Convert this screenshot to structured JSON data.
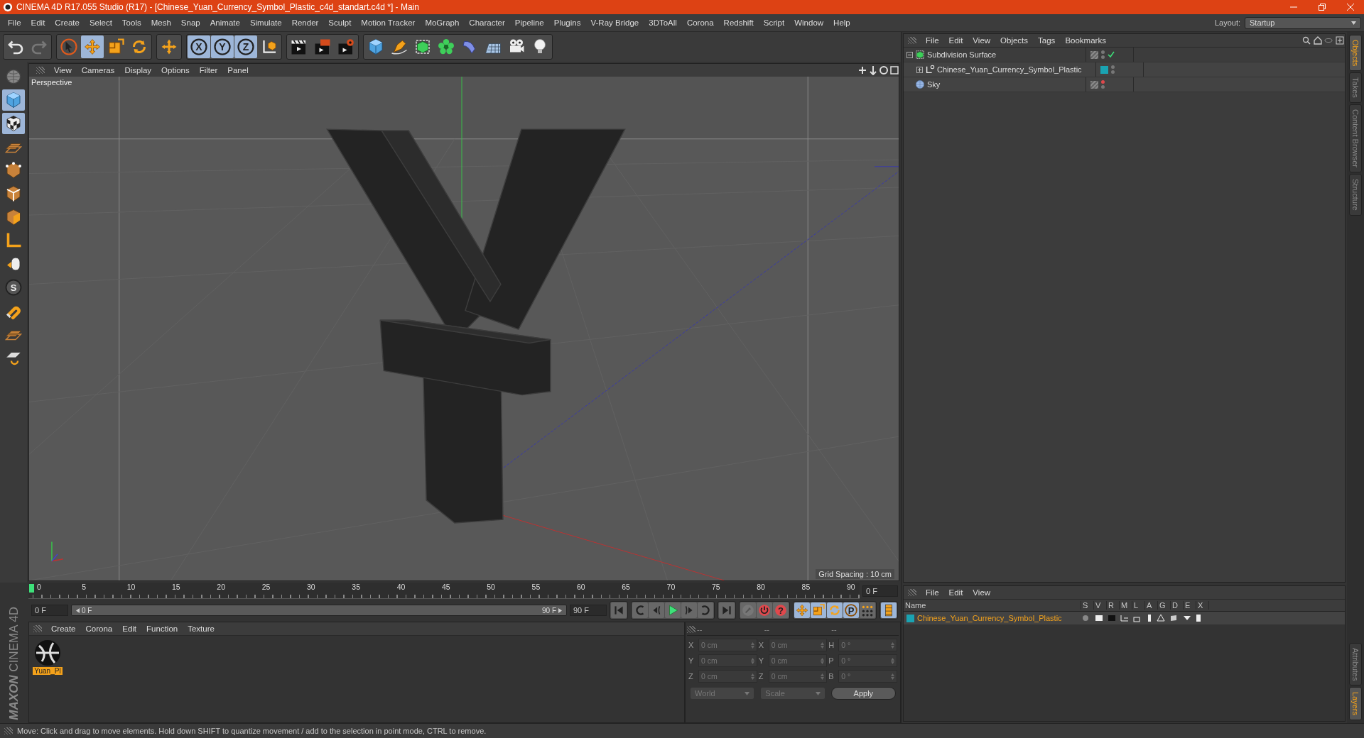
{
  "window": {
    "title": "CINEMA 4D R17.055 Studio (R17) - [Chinese_Yuan_Currency_Symbol_Plastic_c4d_standart.c4d *] - Main"
  },
  "menu": [
    "File",
    "Edit",
    "Create",
    "Select",
    "Tools",
    "Mesh",
    "Snap",
    "Animate",
    "Simulate",
    "Render",
    "Sculpt",
    "Motion Tracker",
    "MoGraph",
    "Character",
    "Pipeline",
    "Plugins",
    "V-Ray Bridge",
    "3DToAll",
    "Corona",
    "Redshift",
    "Script",
    "Window",
    "Help"
  ],
  "layout": {
    "label": "Layout:",
    "value": "Startup"
  },
  "toolbar": [
    [
      {
        "kind": "undo",
        "selected": false
      },
      {
        "kind": "redo",
        "selected": false
      }
    ],
    [
      {
        "kind": "select",
        "selected": false
      },
      {
        "kind": "move",
        "selected": true
      },
      {
        "kind": "scale",
        "selected": false
      },
      {
        "kind": "rotate",
        "selected": false
      }
    ],
    [
      {
        "kind": "cross",
        "selected": false
      }
    ],
    [
      {
        "kind": "axis",
        "label": "X",
        "selected": true
      },
      {
        "kind": "axis",
        "label": "Y",
        "selected": true
      },
      {
        "kind": "axis",
        "label": "Z",
        "selected": true
      },
      {
        "kind": "coord",
        "selected": false
      }
    ],
    [
      {
        "kind": "render",
        "selected": false
      },
      {
        "kind": "render-view",
        "selected": false
      },
      {
        "kind": "render-settings",
        "selected": false
      }
    ],
    [
      {
        "kind": "cube",
        "selected": false
      },
      {
        "kind": "pen",
        "selected": false
      },
      {
        "kind": "subdiv",
        "selected": false
      },
      {
        "kind": "cloner",
        "selected": false
      },
      {
        "kind": "deformer",
        "selected": false
      },
      {
        "kind": "floor",
        "selected": false
      },
      {
        "kind": "camera",
        "selected": false
      },
      {
        "kind": "light",
        "selected": false
      }
    ]
  ],
  "tool_strip": [
    {
      "kind": "model",
      "selected": false
    },
    {
      "kind": "cube",
      "selected": true
    },
    {
      "kind": "texture",
      "selected": true
    },
    {
      "kind": "workplane",
      "selected": false
    },
    {
      "kind": "points",
      "selected": false
    },
    {
      "kind": "edges",
      "selected": false
    },
    {
      "kind": "polys",
      "selected": false
    },
    {
      "kind": "coord-l",
      "selected": false
    },
    {
      "kind": "tweak",
      "selected": false
    },
    {
      "kind": "snap",
      "label": "S",
      "selected": false
    },
    {
      "kind": "magnet",
      "selected": false
    },
    {
      "kind": "workplane",
      "selected": false
    },
    {
      "kind": "workplane-snap",
      "selected": false
    }
  ],
  "viewport": {
    "menu": [
      "View",
      "Cameras",
      "Display",
      "Options",
      "Filter",
      "Panel"
    ],
    "camera": "Perspective",
    "grid_spacing": "Grid Spacing : 10 cm"
  },
  "timeline": {
    "ticks": [
      "0",
      "5",
      "10",
      "15",
      "20",
      "25",
      "30",
      "35",
      "40",
      "45",
      "50",
      "55",
      "60",
      "65",
      "70",
      "75",
      "80",
      "85",
      "90"
    ],
    "current_frame": "0 F"
  },
  "playback": {
    "start": "0 F",
    "range_start": "0 F",
    "range_end": "90 F",
    "end": "90 F",
    "buttons": [
      [
        {
          "kind": "go-start",
          "selected": false
        }
      ],
      [
        {
          "kind": "prev-key",
          "selected": false
        },
        {
          "kind": "prev-frame",
          "selected": false
        },
        {
          "kind": "play",
          "selected": false
        },
        {
          "kind": "next-frame",
          "selected": false
        },
        {
          "kind": "next-key",
          "selected": false
        }
      ],
      [
        {
          "kind": "go-end",
          "selected": false
        }
      ],
      [
        {
          "kind": "key",
          "selected": false
        },
        {
          "kind": "autokey",
          "selected": false
        },
        {
          "kind": "help",
          "label": "?",
          "selected": false
        }
      ],
      [
        {
          "kind": "move",
          "selected": true
        },
        {
          "kind": "scale",
          "selected": true
        },
        {
          "kind": "rotate",
          "selected": true
        },
        {
          "kind": "param",
          "label": "P",
          "selected": true
        },
        {
          "kind": "dots",
          "selected": false
        }
      ],
      [
        {
          "kind": "film",
          "selected": true
        }
      ]
    ]
  },
  "materials": {
    "menu": [
      "Create",
      "Corona",
      "Edit",
      "Function",
      "Texture"
    ],
    "items": [
      {
        "name": "Yuan_Pl",
        "selected": true
      }
    ]
  },
  "coordinates": {
    "headers": [
      "--",
      "--",
      "--"
    ],
    "rows": [
      {
        "axis_1": "X",
        "value_1": "0 cm",
        "axis_2": "X",
        "value_2": "0 cm",
        "axis_3": "H",
        "value_3": "0 °"
      },
      {
        "axis_1": "Y",
        "value_1": "0 cm",
        "axis_2": "Y",
        "value_2": "0 cm",
        "axis_3": "P",
        "value_3": "0 °"
      },
      {
        "axis_1": "Z",
        "value_1": "0 cm",
        "axis_2": "Z",
        "value_2": "0 cm",
        "axis_3": "B",
        "value_3": "0 °"
      }
    ],
    "dropdowns": [
      "World",
      "Scale"
    ],
    "apply": "Apply"
  },
  "status_bar": "Move: Click and drag to move elements. Hold down SHIFT to quantize movement / add to the selection in point mode, CTRL to remove.",
  "object_manager": {
    "menu": [
      "File",
      "Edit",
      "View",
      "Objects",
      "Tags",
      "Bookmarks"
    ],
    "objects": [
      {
        "name": "Subdivision Surface",
        "kind": "subdiv",
        "expanded": true,
        "enabled": true,
        "editor_hidden": false,
        "children": [
          {
            "name": "Chinese_Yuan_Currency_Symbol_Plastic",
            "kind": "null",
            "expanded": false,
            "enabled": false,
            "editor_hidden": false,
            "color": "#1aa3b2"
          }
        ]
      },
      {
        "name": "Sky",
        "kind": "sky",
        "enabled": false,
        "editor_hidden": true
      }
    ]
  },
  "layer_manager": {
    "menu": [
      "File",
      "Edit",
      "View"
    ],
    "columns": [
      "Name",
      "S",
      "V",
      "R",
      "M",
      "L",
      "A",
      "G",
      "D",
      "E",
      "X"
    ],
    "layers": [
      {
        "name": "Chinese_Yuan_Currency_Symbol_Plastic",
        "color": "#1aa3b2"
      }
    ]
  },
  "side_tabs_top": [
    {
      "label": "Objects",
      "selected": true
    },
    {
      "label": "Takes",
      "selected": false
    },
    {
      "label": "Content Browser",
      "selected": false
    },
    {
      "label": "Structure",
      "selected": false
    }
  ],
  "side_tabs_bottom": [
    {
      "label": "Attributes",
      "selected": false
    },
    {
      "label": "Layers",
      "selected": true
    }
  ],
  "logo": {
    "brand": "MAXON",
    "product": "CINEMA 4D"
  }
}
